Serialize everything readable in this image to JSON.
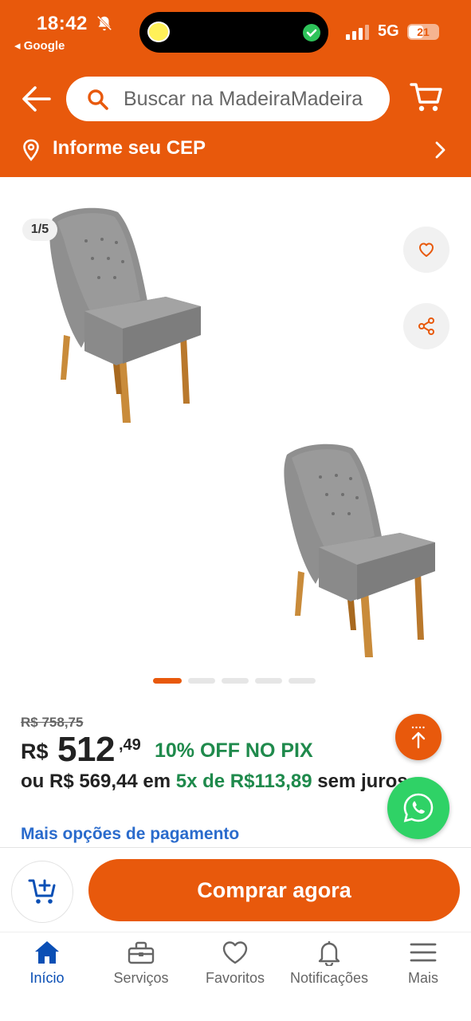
{
  "status_bar": {
    "time": "18:42",
    "back_app": "◂ Google",
    "network": "5G",
    "battery": "21"
  },
  "header": {
    "search_placeholder": "Buscar na MadeiraMadeira",
    "cep_text": "Informe seu CEP"
  },
  "gallery": {
    "counter": "1/5",
    "active_index": 0,
    "total_dots": 5
  },
  "product": {
    "old_price": "R$ 758,75",
    "currency": "R$",
    "price_int": "512",
    "price_cents": ",49",
    "pix_discount": "10% OFF NO PIX",
    "installments_prefix": "ou R$ 569,44 em ",
    "installments_amount": "5x de R$113,89",
    "installments_suffix": " sem juros",
    "more_payment": "Mais opções de pagamento"
  },
  "actions": {
    "buy_label": "Comprar agora"
  },
  "nav": {
    "items": [
      {
        "label": "Início",
        "icon": "home-icon",
        "active": true
      },
      {
        "label": "Serviços",
        "icon": "toolbox-icon",
        "active": false
      },
      {
        "label": "Favoritos",
        "icon": "heart-icon",
        "active": false
      },
      {
        "label": "Notificações",
        "icon": "bell-icon",
        "active": false
      },
      {
        "label": "Mais",
        "icon": "menu-icon",
        "active": false
      }
    ]
  },
  "colors": {
    "brand": "#e8590c",
    "pix_green": "#1f8a4c",
    "link_blue": "#2a6bcc",
    "nav_active": "#0a4fb5"
  }
}
